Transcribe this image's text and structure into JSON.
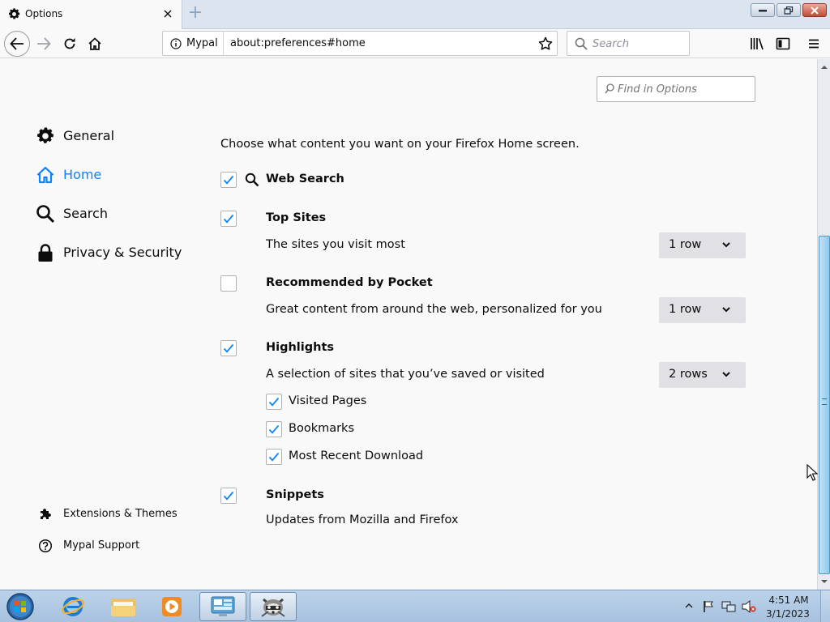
{
  "window": {
    "tab_title": "Options",
    "new_tab_symbol": "+",
    "tab_icon": "gear-icon"
  },
  "nav": {
    "identity_label": "Mypal",
    "url": "about:preferences#home",
    "search_placeholder": "Search"
  },
  "options": {
    "find_placeholder": "Find in Options",
    "categories": [
      {
        "label": "General",
        "icon": "gear-icon",
        "selected": false
      },
      {
        "label": "Home",
        "icon": "home-icon",
        "selected": true
      },
      {
        "label": "Search",
        "icon": "search-icon",
        "selected": false
      },
      {
        "label": "Privacy & Security",
        "icon": "lock-icon",
        "selected": false
      }
    ],
    "footer": {
      "extensions_label": "Extensions & Themes",
      "support_label": "Mypal Support"
    }
  },
  "home": {
    "intro": "Choose what content you want on your Firefox Home screen.",
    "web_search": {
      "label": "Web Search",
      "checked": true
    },
    "top_sites": {
      "label": "Top Sites",
      "desc": "The sites you visit most",
      "checked": true,
      "rows": "1 row"
    },
    "pocket": {
      "label": "Recommended by Pocket",
      "desc": "Great content from around the web, personalized for you",
      "checked": false,
      "rows": "1 row"
    },
    "highlights": {
      "label": "Highlights",
      "desc": "A selection of sites that you’ve saved or visited",
      "checked": true,
      "rows": "2 rows",
      "sub": [
        {
          "label": "Visited Pages",
          "checked": true
        },
        {
          "label": "Bookmarks",
          "checked": true
        },
        {
          "label": "Most Recent Download",
          "checked": true
        }
      ]
    },
    "snippets": {
      "label": "Snippets",
      "desc": "Updates from Mozilla and Firefox",
      "checked": true
    }
  },
  "taskbar": {
    "time": "4:51 AM",
    "date": "3/1/2023"
  },
  "colors": {
    "accent": "#0a84ff",
    "check": "#0a84ff",
    "dropdown_bg": "#e1e1e5"
  }
}
